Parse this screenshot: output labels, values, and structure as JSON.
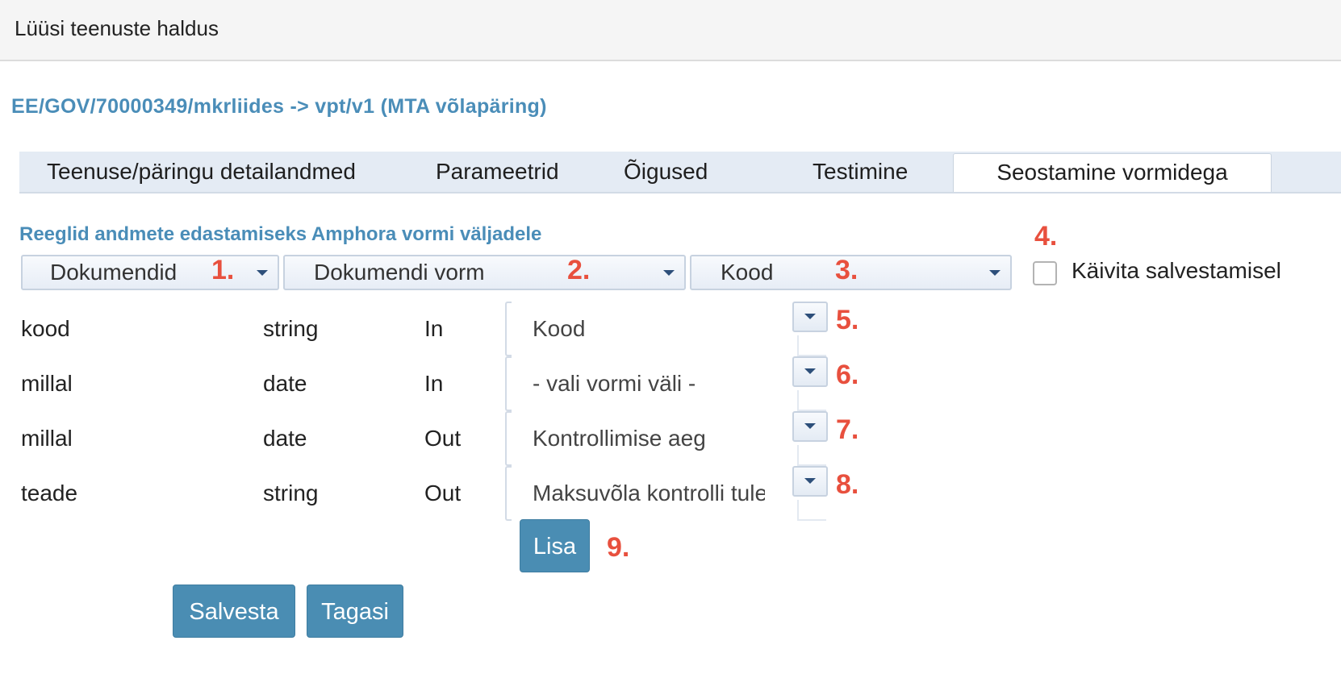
{
  "header": {
    "title": "Lüüsi teenuste haldus"
  },
  "service_path": "EE/GOV/70000349/mkrliides -> vpt/v1 (MTA võlapäring)",
  "tabs": [
    {
      "label": "Teenuse/päringu detailandmed",
      "active": false
    },
    {
      "label": "Parameetrid",
      "active": false
    },
    {
      "label": "Õigused",
      "active": false
    },
    {
      "label": "Testimine",
      "active": false
    },
    {
      "label": "Seostamine vormidega",
      "active": true
    }
  ],
  "section_title": "Reeglid andmete edastamiseks Amphora vormi väljadele",
  "selectors": {
    "documents": "Dokumendid",
    "document_form": "Dokumendi vorm",
    "code": "Kood"
  },
  "checkbox": {
    "label": "Käivita salvestamisel",
    "checked": false
  },
  "rows": [
    {
      "name": "kood",
      "type": "string",
      "direction": "In",
      "field": "Kood"
    },
    {
      "name": "millal",
      "type": "date",
      "direction": "In",
      "field": "- vali vormi väli -"
    },
    {
      "name": "millal",
      "type": "date",
      "direction": "Out",
      "field": "Kontrollimise aeg"
    },
    {
      "name": "teade",
      "type": "string",
      "direction": "Out",
      "field": "Maksuvõla kontrolli tulemus"
    }
  ],
  "buttons": {
    "add": "Lisa",
    "save": "Salvesta",
    "back": "Tagasi"
  },
  "annotations": [
    "1.",
    "2.",
    "3.",
    "4.",
    "5.",
    "6.",
    "7.",
    "8.",
    "9."
  ],
  "colors": {
    "accent_text": "#4a8db8",
    "button_bg": "#4a8db3",
    "annotation": "#e8503e",
    "tabbar_bg": "#e4ebf4"
  },
  "icons": {
    "dropdown": "chevron-down-icon",
    "checkbox": "checkbox-icon"
  }
}
